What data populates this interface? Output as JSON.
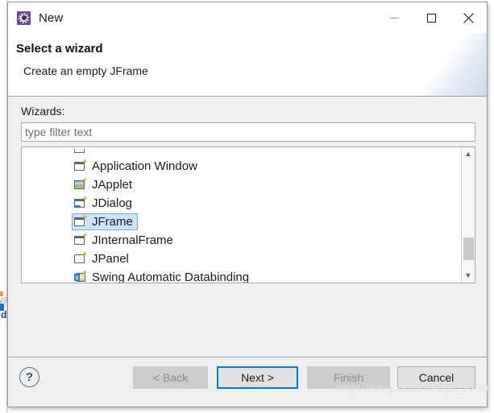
{
  "window": {
    "title": "New",
    "app_icon": "gear-icon",
    "controls": {
      "minimize": "minimize-icon",
      "maximize": "maximize-icon",
      "close": "close-icon"
    }
  },
  "header": {
    "title": "Select a wizard",
    "subtitle": "Create an empty JFrame",
    "banner_icon": "wizard-frame-banner-icon"
  },
  "content": {
    "wizards_label": "Wizards:",
    "filter": {
      "value": "",
      "placeholder": "type filter text"
    },
    "list": {
      "items": [
        {
          "label": "Application Window",
          "icon": "window-wizard-icon",
          "icon_kind": "win",
          "selected": false
        },
        {
          "label": "JApplet",
          "icon": "japplet-wizard-icon",
          "icon_kind": "image",
          "selected": false
        },
        {
          "label": "JDialog",
          "icon": "jdialog-wizard-icon",
          "icon_kind": "dialog",
          "selected": false
        },
        {
          "label": "JFrame",
          "icon": "jframe-wizard-icon",
          "icon_kind": "jframe",
          "selected": true
        },
        {
          "label": "JInternalFrame",
          "icon": "jinternalframe-wizard-icon",
          "icon_kind": "jframe",
          "selected": false
        },
        {
          "label": "JPanel",
          "icon": "jpanel-wizard-icon",
          "icon_kind": "frame-plain",
          "selected": false
        },
        {
          "label": "Swing Automatic Databinding",
          "icon": "databinding-wizard-icon",
          "icon_kind": "databind",
          "selected": false
        }
      ],
      "scrollbar": {
        "up_arrow": "chevron-up-icon",
        "down_arrow": "chevron-down-icon"
      }
    }
  },
  "footer": {
    "help": "?",
    "buttons": {
      "back": "< Back",
      "next": "Next >",
      "finish": "Finish",
      "cancel": "Cancel"
    }
  },
  "watermark": "https://blog.csdn.net/gc_2299",
  "backdrop": {
    "text_a": "va",
    "text_b": "d"
  },
  "colors": {
    "accent_focus": "#0078d7",
    "selection_fill": "#cde3f7",
    "selection_border": "#7aaede",
    "dialog_bg": "#f0f0f0",
    "app_icon_bg": "#6b4d8f",
    "disabled_button": "#cccccc",
    "sparkle": "#e8b33c"
  }
}
